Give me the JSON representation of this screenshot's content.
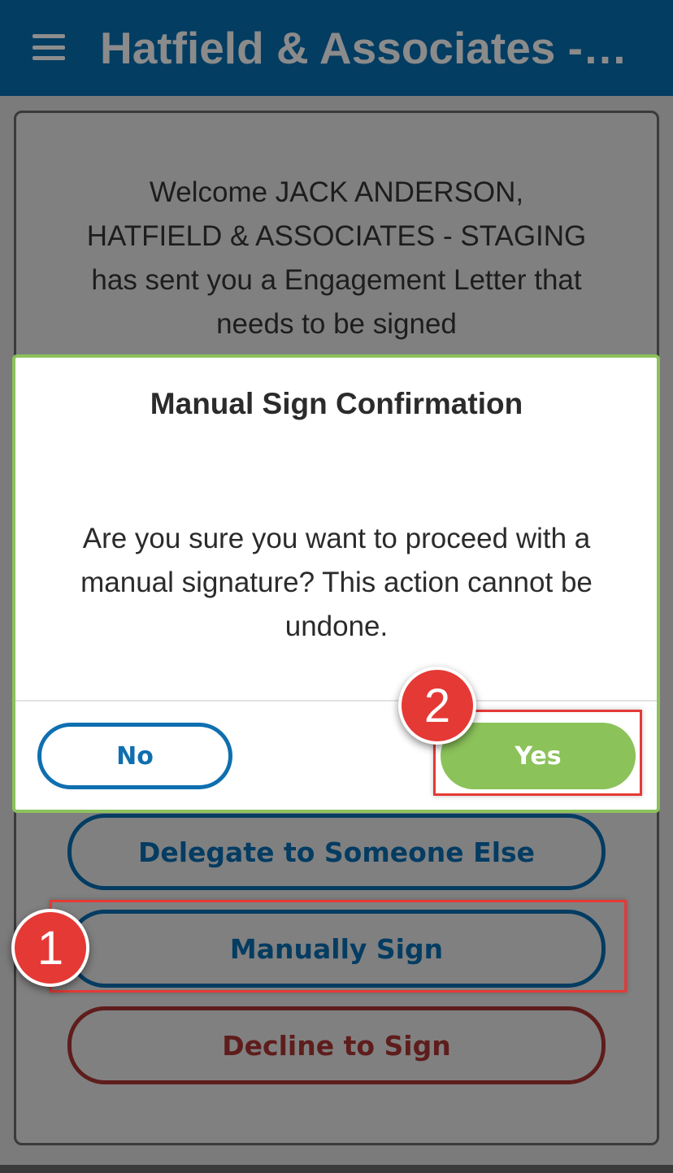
{
  "header": {
    "title": "Hatfield & Associates -…",
    "menu_icon": "hamburger-menu-icon"
  },
  "welcome": {
    "line1": "Welcome JACK ANDERSON,",
    "line2": "HATFIELD & ASSOCIATES - STAGING",
    "line3": "has sent you a Engagement Letter that",
    "line4": "needs to be signed"
  },
  "actions": {
    "delegate": "Delegate to Someone Else",
    "manual_sign": "Manually Sign",
    "decline": "Decline to Sign"
  },
  "modal": {
    "title": "Manual Sign Confirmation",
    "body_line1": "Are you sure you want to proceed with a",
    "body_line2": "manual signature? This action cannot be",
    "body_line3": "undone.",
    "no_label": "No",
    "yes_label": "Yes"
  },
  "annotations": {
    "step1": "1",
    "step2": "2"
  },
  "colors": {
    "header_bg": "#043d62",
    "primary_blue": "#0f6fb0",
    "accent_green": "#8bc25a",
    "decline_red": "#5e1d1c",
    "highlight_red": "#e53935"
  }
}
